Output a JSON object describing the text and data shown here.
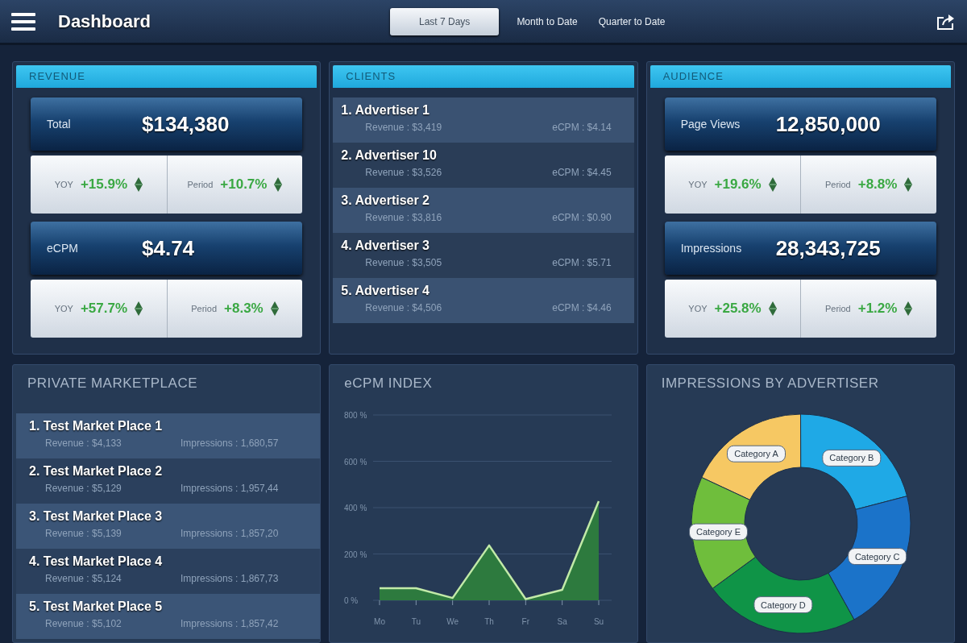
{
  "top_bar": {
    "title": "Dashboard",
    "tabs": [
      {
        "label": "Last 7 Days",
        "selected": true
      },
      {
        "label": "Month to Date",
        "selected": false
      },
      {
        "label": "Quarter to Date",
        "selected": false
      }
    ]
  },
  "revenue": {
    "title": "REVENUE",
    "metrics": [
      {
        "label": "Total",
        "value": "$134,380",
        "changes": [
          {
            "label": "YOY",
            "value": "+15.9%"
          },
          {
            "label": "Period",
            "value": "+10.7%"
          }
        ]
      },
      {
        "label": "eCPM",
        "value": "$4.74",
        "changes": [
          {
            "label": "YOY",
            "value": "+57.7%"
          },
          {
            "label": "Period",
            "value": "+8.3%"
          }
        ]
      }
    ]
  },
  "clients": {
    "title": "CLIENTS",
    "items": [
      {
        "name": "1. Advertiser 1",
        "revenue": "Revenue : $3,419",
        "ecpm": "eCPM : $4.14"
      },
      {
        "name": "2. Advertiser 10",
        "revenue": "Revenue : $3,526",
        "ecpm": "eCPM : $4.45"
      },
      {
        "name": "3. Advertiser 2",
        "revenue": "Revenue : $3,816",
        "ecpm": "eCPM : $0.90"
      },
      {
        "name": "4. Advertiser 3",
        "revenue": "Revenue : $3,505",
        "ecpm": "eCPM : $5.71"
      },
      {
        "name": "5. Advertiser 4",
        "revenue": "Revenue : $4,506",
        "ecpm": "eCPM : $4.46"
      }
    ]
  },
  "audience": {
    "title": "AUDIENCE",
    "metrics": [
      {
        "label": "Page Views",
        "value": "12,850,000",
        "changes": [
          {
            "label": "YOY",
            "value": "+19.6%"
          },
          {
            "label": "Period",
            "value": "+8.8%"
          }
        ]
      },
      {
        "label": "Impressions",
        "value": "28,343,725",
        "changes": [
          {
            "label": "YOY",
            "value": "+25.8%"
          },
          {
            "label": "Period",
            "value": "+1.2%"
          }
        ]
      }
    ]
  },
  "private_marketplace": {
    "title": "PRIVATE MARKETPLACE",
    "items": [
      {
        "name": "1. Test Market Place 1",
        "revenue": "Revenue : $4,133",
        "impressions": "Impressions : 1,680,57"
      },
      {
        "name": "2. Test Market Place 2",
        "revenue": "Revenue : $5,129",
        "impressions": "Impressions : 1,957,44"
      },
      {
        "name": "3. Test Market Place 3",
        "revenue": "Revenue : $5,139",
        "impressions": "Impressions : 1,857,20"
      },
      {
        "name": "4. Test Market Place 4",
        "revenue": "Revenue : $5,124",
        "impressions": "Impressions : 1,867,73"
      },
      {
        "name": "5. Test Market Place 5",
        "revenue": "Revenue : $5,102",
        "impressions": "Impressions : 1,857,42"
      }
    ]
  },
  "ecpm_index": {
    "chart_data": {
      "type": "area",
      "title": "eCPM INDEX",
      "categories": [
        "Mo",
        "Tu",
        "We",
        "Th",
        "Fr",
        "Sa",
        "Su"
      ],
      "values": [
        52,
        52,
        10,
        237,
        5,
        45,
        428
      ],
      "ylim": [
        0,
        800
      ],
      "yticks": [
        {
          "value": 0,
          "label": "0 %"
        },
        {
          "value": 200,
          "label": "200 %"
        },
        {
          "value": 400,
          "label": "400 %"
        },
        {
          "value": 600,
          "label": "600 %"
        },
        {
          "value": 800,
          "label": "800 %"
        }
      ],
      "grid": true
    }
  },
  "impressions_by_advertiser": {
    "chart_data": {
      "type": "donut",
      "title": "IMPRESSIONS BY ADVERTISER",
      "categories": [
        "Category A",
        "Category B",
        "Category C",
        "Category D",
        "Category E"
      ],
      "values": [
        18,
        21,
        21,
        23,
        17
      ],
      "colors": [
        "#f6c863",
        "#1fa9e6",
        "#1b73c9",
        "#0f9447",
        "#6fbe3c"
      ]
    }
  }
}
